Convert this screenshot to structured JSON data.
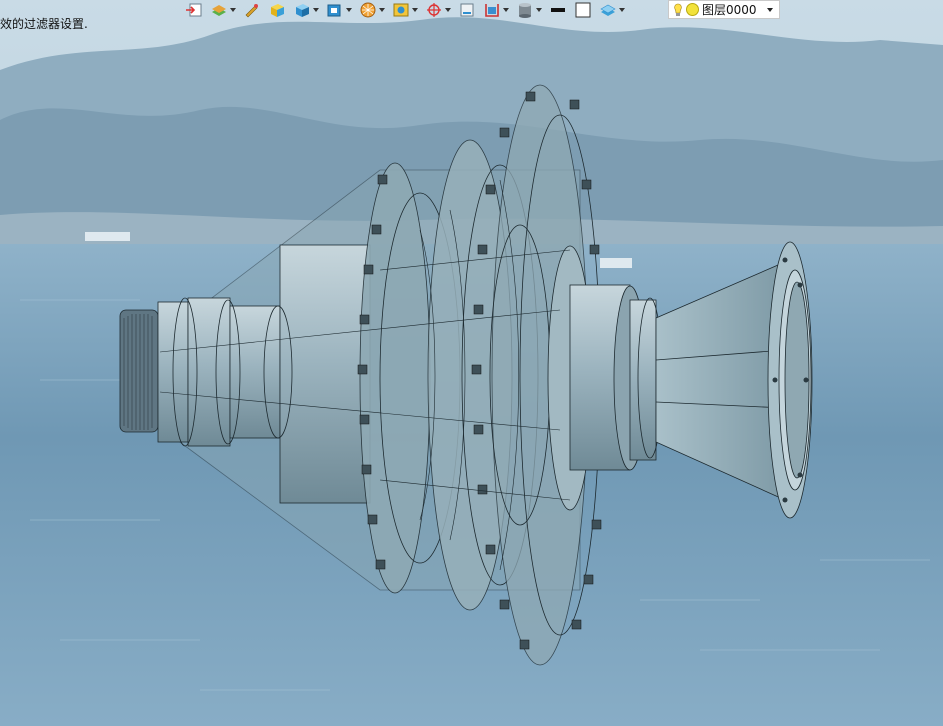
{
  "status": {
    "message": "效的过滤器设置."
  },
  "toolbar": {
    "buttons": [
      {
        "icon": "import-icon",
        "has_dropdown": false
      },
      {
        "icon": "layer-stack-icon",
        "has_dropdown": true
      },
      {
        "icon": "pen-edit-icon",
        "has_dropdown": false
      },
      {
        "icon": "solid-box-yellow-icon",
        "has_dropdown": false
      },
      {
        "icon": "solid-box-blue-icon",
        "has_dropdown": true
      },
      {
        "icon": "view-cube-icon",
        "has_dropdown": true
      },
      {
        "icon": "render-sphere-icon",
        "has_dropdown": true
      },
      {
        "icon": "frame-view-icon",
        "has_dropdown": true
      },
      {
        "icon": "origin-target-icon",
        "has_dropdown": true
      },
      {
        "icon": "panel-icon",
        "has_dropdown": false
      },
      {
        "icon": "section-plane-icon",
        "has_dropdown": true
      },
      {
        "icon": "material-cylinder-icon",
        "has_dropdown": true
      },
      {
        "icon": "line-weight-icon",
        "has_dropdown": false
      },
      {
        "icon": "box-outline-icon",
        "has_dropdown": false
      },
      {
        "icon": "layers-icon",
        "has_dropdown": true
      }
    ],
    "layer": {
      "value": "图层0000",
      "bulb": "lightbulb-icon",
      "color": "#f2e23a"
    }
  },
  "colors": {
    "sky": "#bcd2df",
    "mountain": "#7e9fb4",
    "water": "#6f9ab6",
    "model_body": "#9fb8c3",
    "model_edge": "#1d2a30"
  }
}
